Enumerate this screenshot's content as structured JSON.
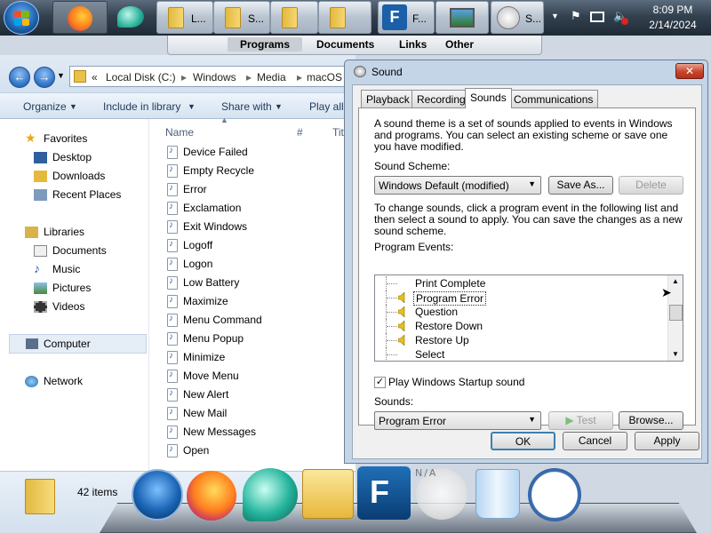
{
  "taskbar": {
    "buttons": [
      {
        "label": "L..."
      },
      {
        "label": "S..."
      },
      {
        "label": ""
      },
      {
        "label": ""
      },
      {
        "label": "F..."
      },
      {
        "label": ""
      },
      {
        "label": "S..."
      }
    ],
    "clock": {
      "time": "8:09 PM",
      "date": "2/14/2024"
    }
  },
  "quickbar": {
    "items": [
      "Programs",
      "Documents",
      "Links",
      "Other"
    ]
  },
  "explorer": {
    "address": {
      "prefix": "«",
      "crumbs": [
        "Local Disk (C:)",
        "Windows",
        "Media",
        "macOS"
      ]
    },
    "toolbar": {
      "organize": "Organize",
      "include": "Include in library",
      "share": "Share with",
      "play": "Play all"
    },
    "columns": {
      "name": "Name",
      "num": "#",
      "title": "Tit"
    },
    "nav": {
      "favorites": "Favorites",
      "desktop": "Desktop",
      "downloads": "Downloads",
      "recent": "Recent Places",
      "libraries": "Libraries",
      "documents": "Documents",
      "music": "Music",
      "pictures": "Pictures",
      "videos": "Videos",
      "computer": "Computer",
      "network": "Network"
    },
    "files": [
      "Device Failed",
      "Empty Recycle",
      "Error",
      "Exclamation",
      "Exit Windows",
      "Logoff",
      "Logon",
      "Low Battery",
      "Maximize",
      "Menu Command",
      "Menu Popup",
      "Minimize",
      "Move Menu",
      "New Alert",
      "New Mail",
      "New Messages",
      "Open"
    ],
    "status": "42 items"
  },
  "sound_dialog": {
    "title": "Sound",
    "close": "✕",
    "tabs": [
      "Playback",
      "Recording",
      "Sounds",
      "Communications"
    ],
    "intro": "A sound theme is a set of sounds applied to events in Windows and programs.  You can select an existing scheme or save one you have modified.",
    "scheme_label": "Sound Scheme:",
    "scheme_value": "Windows Default (modified)",
    "save_as": "Save As...",
    "delete": "Delete",
    "instructions": "To change sounds, click a program event in the following list and then select a sound to apply.  You can save the changes as a new sound scheme.",
    "events_label": "Program Events:",
    "events": [
      {
        "label": "Print Complete",
        "speaker": false,
        "selected": false
      },
      {
        "label": "Program Error",
        "speaker": true,
        "selected": true
      },
      {
        "label": "Question",
        "speaker": true,
        "selected": false
      },
      {
        "label": "Restore Down",
        "speaker": true,
        "selected": false
      },
      {
        "label": "Restore Up",
        "speaker": true,
        "selected": false
      },
      {
        "label": "Select",
        "speaker": false,
        "selected": false
      }
    ],
    "startup_checkbox": {
      "label": "Play Windows Startup sound",
      "checked": true
    },
    "sounds_label": "Sounds:",
    "sound_value": "Program Error",
    "test": "Test",
    "browse": "Browse...",
    "ok": "OK",
    "cancel": "Cancel",
    "apply": "Apply"
  },
  "dock": {
    "na_label": "N/A"
  }
}
